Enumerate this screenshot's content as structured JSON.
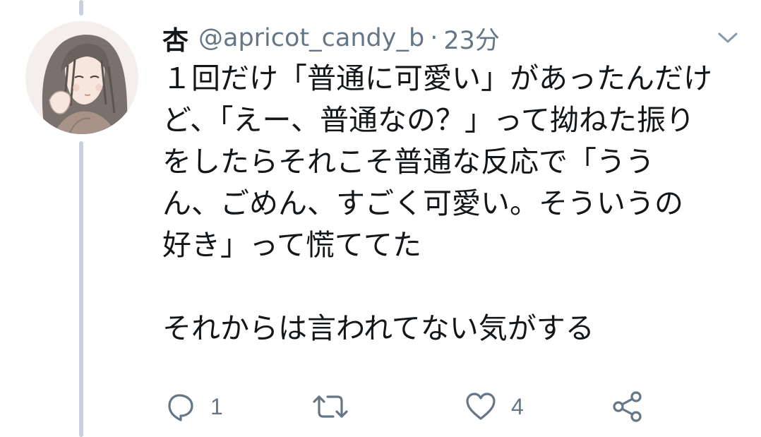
{
  "tweet": {
    "display_name": "杏",
    "handle": "@apricot_candy_b",
    "separator": "·",
    "time": "23分",
    "body_lines": [
      "１回だけ「普通に可愛い」があったんだけ",
      "ど、「えー、普通なの？」って拗ねた振り",
      "をしたらそれこそ普通な反応で「うう",
      "ん、ごめん、すごく可愛い。そういうの",
      "好き」って慌ててた",
      "",
      "それからは言われてない気がする"
    ]
  },
  "actions": {
    "reply": {
      "icon": "reply-icon",
      "count": "1"
    },
    "retweet": {
      "icon": "retweet-icon",
      "count": ""
    },
    "like": {
      "icon": "heart-icon",
      "count": "4"
    },
    "share": {
      "icon": "share-icon"
    }
  },
  "colors": {
    "text": "#14171a",
    "secondary": "#657786",
    "thread_line": "#c7d2dc",
    "background": "#ffffff"
  }
}
